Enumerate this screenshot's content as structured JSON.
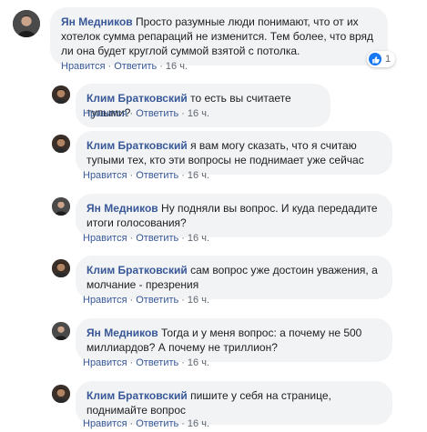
{
  "actions": {
    "like_label": "Нравится",
    "reply_label": "Ответить",
    "separator": "·"
  },
  "comments": [
    {
      "author": "Ян Медников",
      "text": "Просто разумные люди понимают, что от их хотелок сумма репараций не изменится. Тем более, что вряд ли она будет круглой суммой взятой с потолка.",
      "time": "16 ч.",
      "reactions": {
        "icon": "like-icon",
        "count": "1"
      }
    },
    {
      "author": "Клим Братковский",
      "text": "то есть вы считаете тупыми?",
      "time": "16 ч."
    },
    {
      "author": "Клим Братковский",
      "text": "я вам могу сказать, что я считаю тупыми тех, кто эти вопросы не поднимает уже сейчас",
      "time": "16 ч."
    },
    {
      "author": "Ян Медников",
      "text": "Ну подняли вы вопрос. И куда передадите итоги голосования?",
      "time": "16 ч."
    },
    {
      "author": "Клим Братковский",
      "text": "сам вопрос уже достоин уважения, а молчание - презрения",
      "time": "16 ч."
    },
    {
      "author": "Ян Медников",
      "text": "Тогда и у меня вопрос: а почему не 500 миллиардов? А почему не триллион?",
      "time": "16 ч."
    },
    {
      "author": "Клим Братковский",
      "text": "пишите у себя на странице, поднимайте вопрос",
      "time": "16 ч."
    }
  ],
  "colors": {
    "author": "#385898",
    "bubble": "#f2f3f5",
    "like_blue": "#1877f2",
    "meta": "#606770"
  }
}
